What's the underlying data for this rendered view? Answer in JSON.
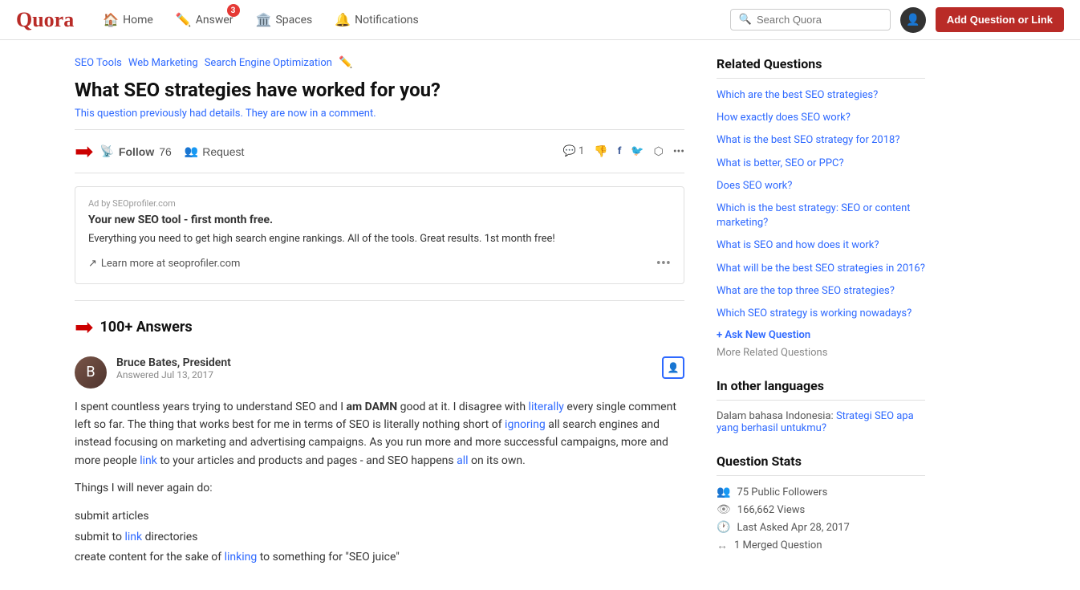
{
  "header": {
    "logo": "Quora",
    "nav": [
      {
        "id": "home",
        "label": "Home",
        "icon": "🏠",
        "badge": null
      },
      {
        "id": "answer",
        "label": "Answer",
        "icon": "✏️",
        "badge": "3"
      },
      {
        "id": "spaces",
        "label": "Spaces",
        "icon": "🏛️",
        "badge": null
      },
      {
        "id": "notifications",
        "label": "Notifications",
        "icon": "🔔",
        "badge": null
      }
    ],
    "search_placeholder": "Search Quora",
    "add_button": "Add Question or Link"
  },
  "breadcrumbs": [
    "SEO Tools",
    "Web Marketing",
    "Search Engine Optimization"
  ],
  "question": {
    "title": "What SEO strategies have worked for you?",
    "note": "This question previously had details. They are now in a comment.",
    "follow_label": "Follow",
    "follow_count": "76",
    "request_label": "Request",
    "comment_count": "1"
  },
  "ad": {
    "label": "Ad by SEOprofiler.com",
    "title": "Your new SEO tool - first month free.",
    "text": "Everything you need to get high search engine rankings. All of the tools. Great results. 1st month free!",
    "link": "Learn more at seoprofiler.com"
  },
  "answers": {
    "count": "100+ Answers",
    "items": [
      {
        "author": "Bruce Bates, President",
        "date": "Answered Jul 13, 2017",
        "initials": "B",
        "text_paragraphs": [
          "I spent countless years trying to understand SEO and I am DAMN good at it. I disagree with literally every single comment left so far. The thing that works best for me in terms of SEO is literally nothing short of ignoring all search engines and instead focusing on marketing and advertising campaigns. As you run more and more successful campaigns, more and more people link to your articles and products and pages - and SEO happens all on its own.",
          "Things I will never again do:"
        ],
        "list_items": [
          "submit articles",
          "submit to link directories",
          "create content for the sake of linking to something for \"SEO juice\""
        ]
      }
    ]
  },
  "related_questions": {
    "title": "Related Questions",
    "items": [
      "Which are the best SEO strategies?",
      "How exactly does SEO work?",
      "What is the best SEO strategy for 2018?",
      "What is better, SEO or PPC?",
      "Does SEO work?",
      "Which is the best strategy: SEO or content marketing?",
      "What is SEO and how does it work?",
      "What will be the best SEO strategies in 2016?",
      "What are the top three SEO strategies?",
      "Which SEO strategy is working nowadays?"
    ],
    "ask_new": "+ Ask New Question",
    "more": "More Related Questions"
  },
  "other_languages": {
    "title": "In other languages",
    "text": "Dalam bahasa Indonesia:",
    "link_text": "Strategi SEO apa yang berhasil untukmu?",
    "link_href": "#"
  },
  "question_stats": {
    "title": "Question Stats",
    "followers": "75 Public Followers",
    "views": "166,662 Views",
    "last_asked": "Last Asked Apr 28, 2017",
    "merged": "1 Merged Question"
  }
}
